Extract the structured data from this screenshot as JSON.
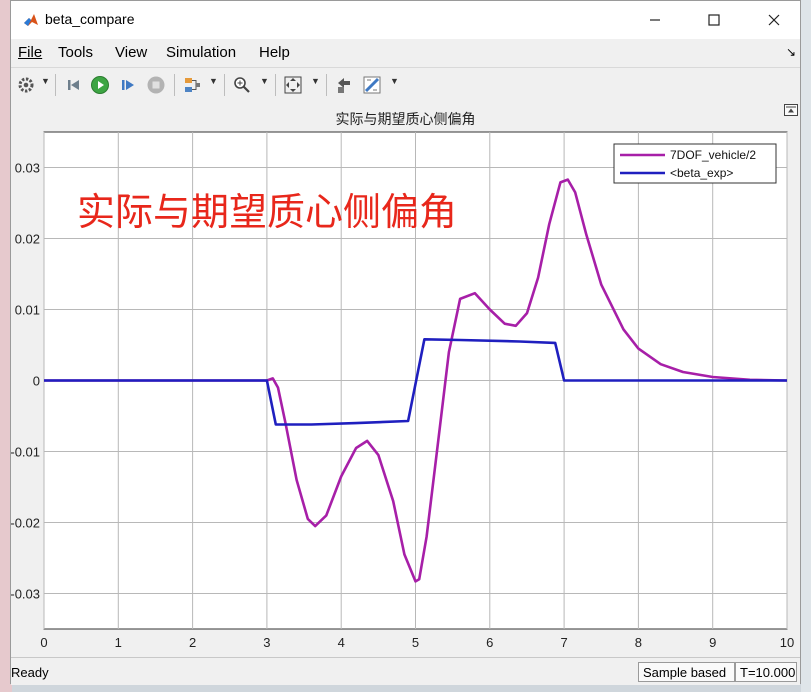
{
  "window": {
    "title": "beta_compare",
    "controls": [
      "minimize-icon",
      "maximize-icon",
      "close-icon"
    ]
  },
  "menu": [
    {
      "label": "File"
    },
    {
      "label": "Tools"
    },
    {
      "label": "View"
    },
    {
      "label": "Simulation"
    },
    {
      "label": "Help"
    }
  ],
  "toolbar": [
    "settings-gear-icon",
    "step-back-icon",
    "run-icon",
    "step-forward-icon",
    "stop-icon",
    "signal-selector-icon",
    "zoom-icon",
    "fit-to-view-icon",
    "highlight-block-icon",
    "measure-icon"
  ],
  "plot": {
    "title": "实际与期望质心侧偏角",
    "annotation": "实际与期望质心侧偏角",
    "annotation_color": "#e8271b",
    "background": "#ffffff",
    "grid_color": "#b8b8b8"
  },
  "chart_data": {
    "type": "line",
    "title": "实际与期望质心侧偏角",
    "xlabel": "",
    "ylabel": "",
    "xlim": [
      0,
      10
    ],
    "ylim": [
      -0.035,
      0.035
    ],
    "xticks": [
      "0",
      "1",
      "2",
      "3",
      "4",
      "5",
      "6",
      "7",
      "8",
      "9",
      "10"
    ],
    "yticks": [
      "0.03",
      "0.02",
      "0.01",
      "0",
      "-0.01",
      "-0.02",
      "-0.03"
    ],
    "grid": true,
    "legend_position": "top-right",
    "series": [
      {
        "name": "7DOF_vehicle/2",
        "color": "#a71fa8",
        "x": [
          0,
          3,
          3.08,
          3.15,
          3.25,
          3.4,
          3.55,
          3.65,
          3.8,
          4.0,
          4.2,
          4.35,
          4.5,
          4.7,
          4.85,
          5.0,
          5.05,
          5.15,
          5.3,
          5.45,
          5.6,
          5.8,
          6.0,
          6.2,
          6.35,
          6.5,
          6.65,
          6.8,
          6.95,
          7.05,
          7.15,
          7.3,
          7.5,
          7.8,
          8.0,
          8.3,
          8.6,
          9.0,
          9.5,
          10.0
        ],
        "y": [
          0,
          0,
          0.0003,
          -0.001,
          -0.006,
          -0.014,
          -0.0195,
          -0.0205,
          -0.019,
          -0.0135,
          -0.0095,
          -0.0085,
          -0.0105,
          -0.017,
          -0.0245,
          -0.0283,
          -0.028,
          -0.022,
          -0.009,
          0.004,
          0.0115,
          0.0123,
          0.01,
          0.008,
          0.0077,
          0.0095,
          0.0145,
          0.022,
          0.0279,
          0.0283,
          0.0265,
          0.0205,
          0.0135,
          0.0072,
          0.0045,
          0.0023,
          0.0012,
          0.0005,
          0.0001,
          0
        ]
      },
      {
        "name": "<beta_exp>",
        "color": "#1f1fbf",
        "x": [
          0,
          3,
          3.12,
          3.6,
          4.2,
          4.9,
          5.12,
          5.6,
          6.4,
          6.88,
          7.0,
          8,
          9,
          10
        ],
        "y": [
          0,
          0,
          -0.0062,
          -0.0062,
          -0.006,
          -0.0057,
          0.0058,
          0.0057,
          0.0055,
          0.0053,
          0,
          0,
          0,
          0
        ]
      }
    ]
  },
  "status": {
    "ready": "Ready",
    "sample_mode": "Sample based",
    "time": "T=10.000"
  }
}
